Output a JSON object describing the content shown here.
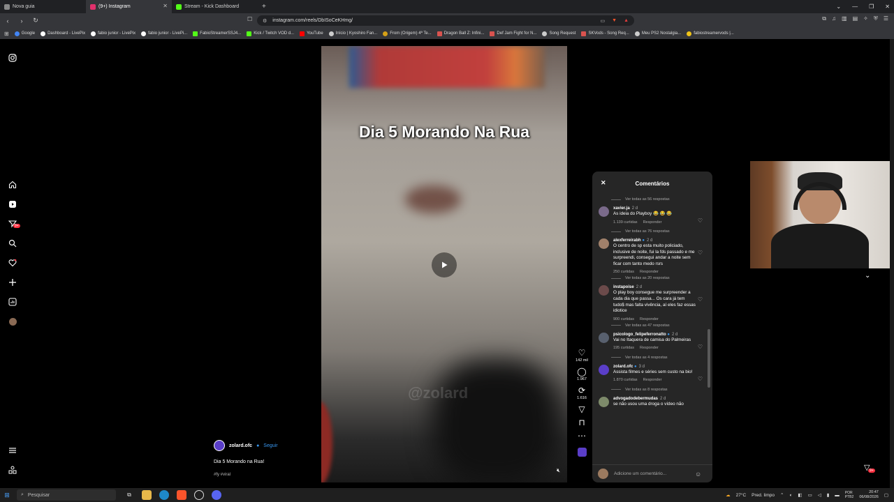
{
  "browser": {
    "tabs": [
      {
        "label": "Nova guia",
        "color": "#888888"
      },
      {
        "label": "(9+) Instagram",
        "color": "#e1306c"
      },
      {
        "label": "Stream - Kick Dashboard",
        "color": "#53fc18"
      }
    ],
    "url": "instagram.com/reels/DbISoCeKHmg/",
    "bookmarks": [
      {
        "label": "Google",
        "color": "#4285f4"
      },
      {
        "label": "Dashboard - LivePix",
        "color": "#ffffff"
      },
      {
        "label": "fabio junior - LivePix",
        "color": "#ffffff"
      },
      {
        "label": "fabio junior - LivePi...",
        "color": "#ffffff"
      },
      {
        "label": "FabioStreamerSSJ4...",
        "color": "#53fc18"
      },
      {
        "label": "Kick / Twitch VOD d...",
        "color": "#53fc18"
      },
      {
        "label": "YouTube",
        "color": "#ff0000"
      },
      {
        "label": "Início | Kyoshiro Fan...",
        "color": "#cccccc"
      },
      {
        "label": "From (Origem) 4ª Te...",
        "color": "#d4a017"
      },
      {
        "label": "Dragon Ball Z: Infini...",
        "color": "#d9534f"
      },
      {
        "label": "Def Jam Fight for N...",
        "color": "#d9534f"
      },
      {
        "label": "Song Request",
        "color": "#cccccc"
      },
      {
        "label": "SKVods - Song Req...",
        "color": "#d9534f"
      },
      {
        "label": "Meu PS2 Nostalgia...",
        "color": "#cccccc"
      },
      {
        "label": "fabiostreamervods |...",
        "color": "#f0c419"
      }
    ]
  },
  "reel": {
    "overlay_title": "Dia 5 Morando Na Rua",
    "watermark": "@zolard",
    "actions": {
      "likes": "142 mil",
      "comments": "1.967",
      "reposts": "1.616"
    },
    "caption": {
      "username": "zolard.ofc",
      "follow": "Seguir",
      "text": "Dia 5 Morando na Rua!",
      "tags": "#fy #viral"
    }
  },
  "comments_panel": {
    "title": "Comentários",
    "items": [
      {
        "type": "replies",
        "text": "Ver todas as 56 respostas"
      },
      {
        "type": "comment",
        "user": "xavier.ja",
        "time": "2 d",
        "text": "As ideia do Playboy 😂 😂 😂",
        "likes": "1.139 curtidas",
        "reply": "Responder",
        "avatar": "#7a6a8a"
      },
      {
        "type": "replies",
        "text": "Ver todas as 76 respostas"
      },
      {
        "type": "comment",
        "user": "alexferreirabh",
        "verified": true,
        "time": "2 d",
        "text": "O centro de sp esta muito policiado, inclusive de noite, fui la fds passado e me surpreendi, consegui andar a noite sem ficar com tanto medo rsrs",
        "likes": "250 curtidas",
        "reply": "Responder",
        "avatar": "#a0806a"
      },
      {
        "type": "replies",
        "text": "Ver todas as 20 respostas"
      },
      {
        "type": "comment",
        "user": "instapoise",
        "time": "2 d",
        "text": "O play boy consegue me surpreender a cada dia que passa... Os cara já tem tudo$ mas falta vivência, aí eles faz essas idiotice",
        "likes": "900 curtidas",
        "reply": "Responder",
        "avatar": "#6b4a4a"
      },
      {
        "type": "replies",
        "text": "Ver todas as 47 respostas"
      },
      {
        "type": "comment",
        "user": "psicologo_felipeferronatto",
        "verified": true,
        "time": "2 d",
        "text": "Vai no Itaquera de camisa do Palmeiras",
        "likes": "195 curtidas",
        "reply": "Responder",
        "avatar": "#58606e"
      },
      {
        "type": "replies",
        "text": "Ver todas as 4 respostas"
      },
      {
        "type": "comment",
        "user": "zolard.ofc",
        "verified": true,
        "time": "3 d",
        "text": "Assista filmes e séries sem custo na bio!",
        "likes": "1.870 curtidas",
        "reply": "Responder",
        "avatar": "#5a3ec8"
      },
      {
        "type": "replies",
        "text": "Ver todas as 8 respostas"
      },
      {
        "type": "comment",
        "user": "advogadodebermudas",
        "time": "2 d",
        "text": "se não usou uma droga o vídeo não",
        "likes": "",
        "reply": "",
        "avatar": "#7d8a6a"
      }
    ],
    "input_placeholder": "Adicione um comentário..."
  },
  "taskbar": {
    "search_placeholder": "Pesquisar",
    "weather": "27°C",
    "weather_desc": "Pred. limpo",
    "lang1": "POR",
    "lang2": "PTB2",
    "time": "20:47",
    "date": "06/08/2026"
  }
}
